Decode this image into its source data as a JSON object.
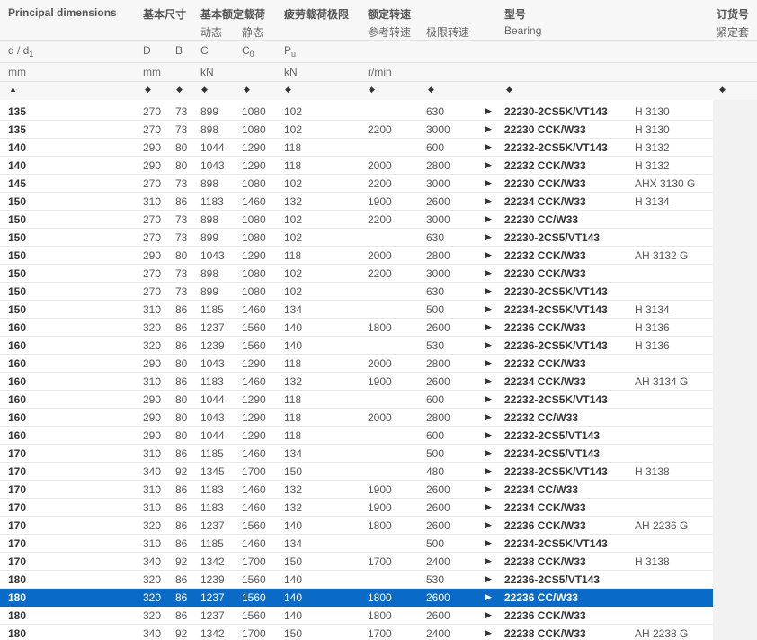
{
  "header": {
    "principal": "Principal dimensions",
    "basic_size": "基本尺寸",
    "basic_load": "基本额定载荷",
    "dynamic": "动态",
    "static": "静态",
    "fatigue": "疲劳载荷极限",
    "rated_speed": "额定转速",
    "ref_speed": "参考转速",
    "limit_speed": "极限转速",
    "type": "型号",
    "bearing": "Bearing",
    "order": "订货号",
    "sleeve": "紧定套",
    "sym_d": "d / d",
    "sym_d_sub": "1",
    "sym_D": "D",
    "sym_B": "B",
    "sym_C": "C",
    "sym_C0": "C",
    "sym_C0_sub": "0",
    "sym_Pu": "P",
    "sym_Pu_sub": "u",
    "unit_mm1": "mm",
    "unit_mm2": "mm",
    "unit_kN1": "kN",
    "unit_kN2": "kN",
    "unit_rmin": "r/min",
    "sort_first": "▲",
    "sort": "◆"
  },
  "selected_index": 27,
  "rows": [
    {
      "d": "135",
      "D": "270",
      "B": "73",
      "C": "899",
      "C0": "1080",
      "Pu": "102",
      "ref": "",
      "lim": "630",
      "bearing": "22230-2CS5K/VT143",
      "sleeve": "H 3130"
    },
    {
      "d": "135",
      "D": "270",
      "B": "73",
      "C": "898",
      "C0": "1080",
      "Pu": "102",
      "ref": "2200",
      "lim": "3000",
      "bearing": "22230 CCK/W33",
      "sleeve": "H 3130"
    },
    {
      "d": "140",
      "D": "290",
      "B": "80",
      "C": "1044",
      "C0": "1290",
      "Pu": "118",
      "ref": "",
      "lim": "600",
      "bearing": "22232-2CS5K/VT143",
      "sleeve": "H 3132"
    },
    {
      "d": "140",
      "D": "290",
      "B": "80",
      "C": "1043",
      "C0": "1290",
      "Pu": "118",
      "ref": "2000",
      "lim": "2800",
      "bearing": "22232 CCK/W33",
      "sleeve": "H 3132"
    },
    {
      "d": "145",
      "D": "270",
      "B": "73",
      "C": "898",
      "C0": "1080",
      "Pu": "102",
      "ref": "2200",
      "lim": "3000",
      "bearing": "22230 CCK/W33",
      "sleeve": "AHX 3130 G"
    },
    {
      "d": "150",
      "D": "310",
      "B": "86",
      "C": "1183",
      "C0": "1460",
      "Pu": "132",
      "ref": "1900",
      "lim": "2600",
      "bearing": "22234 CCK/W33",
      "sleeve": "H 3134"
    },
    {
      "d": "150",
      "D": "270",
      "B": "73",
      "C": "898",
      "C0": "1080",
      "Pu": "102",
      "ref": "2200",
      "lim": "3000",
      "bearing": "22230 CC/W33",
      "sleeve": ""
    },
    {
      "d": "150",
      "D": "270",
      "B": "73",
      "C": "899",
      "C0": "1080",
      "Pu": "102",
      "ref": "",
      "lim": "630",
      "bearing": "22230-2CS5/VT143",
      "sleeve": ""
    },
    {
      "d": "150",
      "D": "290",
      "B": "80",
      "C": "1043",
      "C0": "1290",
      "Pu": "118",
      "ref": "2000",
      "lim": "2800",
      "bearing": "22232 CCK/W33",
      "sleeve": "AH 3132 G"
    },
    {
      "d": "150",
      "D": "270",
      "B": "73",
      "C": "898",
      "C0": "1080",
      "Pu": "102",
      "ref": "2200",
      "lim": "3000",
      "bearing": "22230 CCK/W33",
      "sleeve": ""
    },
    {
      "d": "150",
      "D": "270",
      "B": "73",
      "C": "899",
      "C0": "1080",
      "Pu": "102",
      "ref": "",
      "lim": "630",
      "bearing": "22230-2CS5K/VT143",
      "sleeve": ""
    },
    {
      "d": "150",
      "D": "310",
      "B": "86",
      "C": "1185",
      "C0": "1460",
      "Pu": "134",
      "ref": "",
      "lim": "500",
      "bearing": "22234-2CS5K/VT143",
      "sleeve": "H 3134"
    },
    {
      "d": "160",
      "D": "320",
      "B": "86",
      "C": "1237",
      "C0": "1560",
      "Pu": "140",
      "ref": "1800",
      "lim": "2600",
      "bearing": "22236 CCK/W33",
      "sleeve": "H 3136"
    },
    {
      "d": "160",
      "D": "320",
      "B": "86",
      "C": "1239",
      "C0": "1560",
      "Pu": "140",
      "ref": "",
      "lim": "530",
      "bearing": "22236-2CS5K/VT143",
      "sleeve": "H 3136"
    },
    {
      "d": "160",
      "D": "290",
      "B": "80",
      "C": "1043",
      "C0": "1290",
      "Pu": "118",
      "ref": "2000",
      "lim": "2800",
      "bearing": "22232 CCK/W33",
      "sleeve": ""
    },
    {
      "d": "160",
      "D": "310",
      "B": "86",
      "C": "1183",
      "C0": "1460",
      "Pu": "132",
      "ref": "1900",
      "lim": "2600",
      "bearing": "22234 CCK/W33",
      "sleeve": "AH 3134 G"
    },
    {
      "d": "160",
      "D": "290",
      "B": "80",
      "C": "1044",
      "C0": "1290",
      "Pu": "118",
      "ref": "",
      "lim": "600",
      "bearing": "22232-2CS5K/VT143",
      "sleeve": ""
    },
    {
      "d": "160",
      "D": "290",
      "B": "80",
      "C": "1043",
      "C0": "1290",
      "Pu": "118",
      "ref": "2000",
      "lim": "2800",
      "bearing": "22232 CC/W33",
      "sleeve": ""
    },
    {
      "d": "160",
      "D": "290",
      "B": "80",
      "C": "1044",
      "C0": "1290",
      "Pu": "118",
      "ref": "",
      "lim": "600",
      "bearing": "22232-2CS5/VT143",
      "sleeve": ""
    },
    {
      "d": "170",
      "D": "310",
      "B": "86",
      "C": "1185",
      "C0": "1460",
      "Pu": "134",
      "ref": "",
      "lim": "500",
      "bearing": "22234-2CS5/VT143",
      "sleeve": ""
    },
    {
      "d": "170",
      "D": "340",
      "B": "92",
      "C": "1345",
      "C0": "1700",
      "Pu": "150",
      "ref": "",
      "lim": "480",
      "bearing": "22238-2CS5K/VT143",
      "sleeve": "H 3138"
    },
    {
      "d": "170",
      "D": "310",
      "B": "86",
      "C": "1183",
      "C0": "1460",
      "Pu": "132",
      "ref": "1900",
      "lim": "2600",
      "bearing": "22234 CC/W33",
      "sleeve": ""
    },
    {
      "d": "170",
      "D": "310",
      "B": "86",
      "C": "1183",
      "C0": "1460",
      "Pu": "132",
      "ref": "1900",
      "lim": "2600",
      "bearing": "22234 CCK/W33",
      "sleeve": ""
    },
    {
      "d": "170",
      "D": "320",
      "B": "86",
      "C": "1237",
      "C0": "1560",
      "Pu": "140",
      "ref": "1800",
      "lim": "2600",
      "bearing": "22236 CCK/W33",
      "sleeve": "AH 2236 G"
    },
    {
      "d": "170",
      "D": "310",
      "B": "86",
      "C": "1185",
      "C0": "1460",
      "Pu": "134",
      "ref": "",
      "lim": "500",
      "bearing": "22234-2CS5K/VT143",
      "sleeve": ""
    },
    {
      "d": "170",
      "D": "340",
      "B": "92",
      "C": "1342",
      "C0": "1700",
      "Pu": "150",
      "ref": "1700",
      "lim": "2400",
      "bearing": "22238 CCK/W33",
      "sleeve": "H 3138"
    },
    {
      "d": "180",
      "D": "320",
      "B": "86",
      "C": "1239",
      "C0": "1560",
      "Pu": "140",
      "ref": "",
      "lim": "530",
      "bearing": "22236-2CS5/VT143",
      "sleeve": ""
    },
    {
      "d": "180",
      "D": "320",
      "B": "86",
      "C": "1237",
      "C0": "1560",
      "Pu": "140",
      "ref": "1800",
      "lim": "2600",
      "bearing": "22236 CC/W33",
      "sleeve": ""
    },
    {
      "d": "180",
      "D": "320",
      "B": "86",
      "C": "1237",
      "C0": "1560",
      "Pu": "140",
      "ref": "1800",
      "lim": "2600",
      "bearing": "22236 CCK/W33",
      "sleeve": ""
    },
    {
      "d": "180",
      "D": "340",
      "B": "92",
      "C": "1342",
      "C0": "1700",
      "Pu": "150",
      "ref": "1700",
      "lim": "2400",
      "bearing": "22238 CCK/W33",
      "sleeve": "AH 2238 G"
    }
  ],
  "row_arrow": "▶"
}
